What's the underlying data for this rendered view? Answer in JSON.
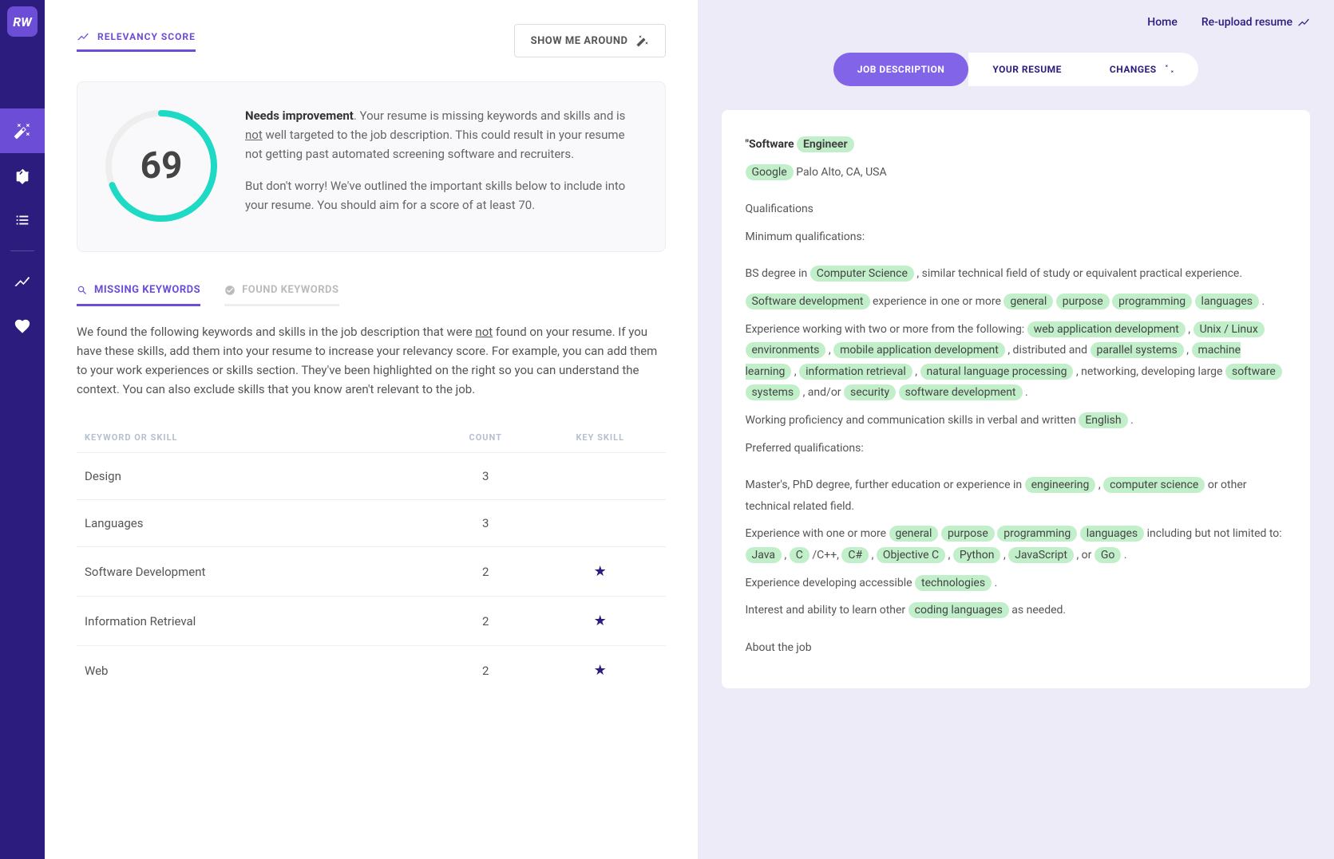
{
  "logo": "RW",
  "leftPanel": {
    "sectionTitle": "RELEVANCY SCORE",
    "showMeButton": "SHOW ME AROUND",
    "score": "69",
    "scoreHeading": "Needs improvement",
    "scoreText1a": ". Your resume is missing keywords and skills and is ",
    "scoreText1not": "not",
    "scoreText1b": " well targeted to the job description. This could result in your resume not getting past automated screening software and recruiters.",
    "scoreText2": "But don't worry! We've outlined the important skills below to include into your resume. You should aim for a score of at least 70.",
    "tabs": {
      "missing": "MISSING KEYWORDS",
      "found": "FOUND KEYWORDS"
    },
    "keywordsDesc1": "We found the following keywords and skills in the job description that were ",
    "keywordsDescNot": "not",
    "keywordsDesc2": " found on your resume. If you have these skills, add them into your resume to increase your relevancy score. For example, you can add them to your work experiences or skills section. They've been highlighted on the right so you can understand the context. You can also exclude skills that you know aren't relevant to the job.",
    "tableHeaders": {
      "keyword": "KEYWORD OR SKILL",
      "count": "COUNT",
      "keySkill": "KEY SKILL"
    },
    "rows": [
      {
        "keyword": "Design",
        "count": "3",
        "key": false
      },
      {
        "keyword": "Languages",
        "count": "3",
        "key": false
      },
      {
        "keyword": "Software Development",
        "count": "2",
        "key": true
      },
      {
        "keyword": "Information Retrieval",
        "count": "2",
        "key": true
      },
      {
        "keyword": "Web",
        "count": "2",
        "key": true
      }
    ]
  },
  "rightPanel": {
    "links": {
      "home": "Home",
      "reupload": "Re-upload resume"
    },
    "pillTabs": {
      "jd": "JOB DESCRIPTION",
      "resume": "YOUR RESUME",
      "changes": "CHANGES"
    },
    "jd": {
      "titlePrefix": "\"Software",
      "titleHl": "Engineer",
      "locationHl": "Google",
      "locationText": "Palo Alto, CA, USA",
      "qualifications": "Qualifications",
      "minQuals": "Minimum qualifications:",
      "bs1": "BS degree in",
      "bs_hl": "Computer Science",
      "bs2": ", similar technical field of study or equivalent practical experience.",
      "exp_hl1": "Software development",
      "exp1": "experience in one or more",
      "exp_hl2": "general",
      "exp_hl3": "purpose",
      "exp_hl4": "programming",
      "exp_hl5": "languages",
      "expEnd": ".",
      "work1": "Experience working with two or more from the following:",
      "work_hl1": "web application development",
      "workComma": ",",
      "work_hl2": "Unix / Linux",
      "work_hl3": "environments",
      "work_hl4": "mobile application development",
      "work2": ", distributed and",
      "work_hl5": "parallel systems",
      "work_hl6": "machine learning",
      "work_hl7": "information retrieval",
      "work_hl8": "natural language processing",
      "work3": ", networking, developing large",
      "work_hl9": "software",
      "work_hl10": "systems",
      "work4": ", and/or",
      "work_hl11": "security",
      "work_hl12": "software development",
      "workEnd": ".",
      "prof1": "Working proficiency and communication skills in verbal and written",
      "prof_hl": "English",
      "profEnd": ".",
      "prefQuals": "Preferred qualifications:",
      "masters1": "Master's, PhD degree, further education or experience in",
      "masters_hl1": "engineering",
      "masters_hl2": "computer science",
      "masters2": "or other technical related field.",
      "lang1": "Experience with one or more",
      "lang_hl1": "general",
      "lang_hl2": "purpose",
      "lang_hl3": "programming",
      "lang_hl4": "languages",
      "lang2": "including but not limited to:",
      "lang_hl5": "Java",
      "lang_hl6": "C",
      "lang3": "/C++,",
      "lang_hl7": "C#",
      "lang_hl8": "Objective C",
      "lang_hl9": "Python",
      "lang_hl10": "JavaScript",
      "lang4": ", or",
      "lang_hl11": "Go",
      "langEnd": ".",
      "tech1": "Experience developing accessible",
      "tech_hl": "technologies",
      "techEnd": ".",
      "learn1": "Interest and ability to learn other",
      "learn_hl": "coding languages",
      "learn2": "as needed.",
      "about": "About the job"
    }
  }
}
